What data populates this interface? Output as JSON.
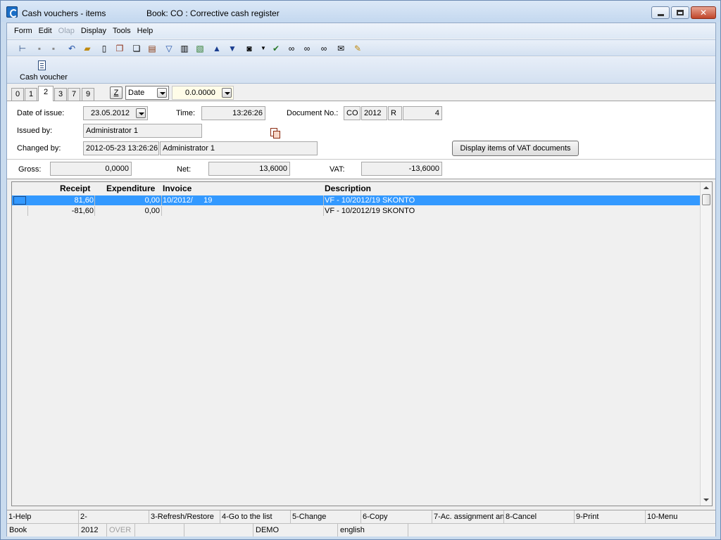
{
  "window": {
    "title": "Cash vouchers - items",
    "book": "Book: CO : Corrective cash register"
  },
  "menu": [
    "Form",
    "Edit",
    "Olap",
    "Display",
    "Tools",
    "Help"
  ],
  "ribbon": {
    "cash_voucher": "Cash voucher"
  },
  "tabs": [
    "0",
    "1",
    "2",
    "3",
    "7",
    "9"
  ],
  "filter": {
    "z_label": "Z",
    "sort_value": "Date",
    "amount_value": "0.0.0000"
  },
  "form": {
    "date_of_issue_label": "Date of issue:",
    "date_of_issue": "23.05.2012",
    "time_label": "Time:",
    "time": "13:26:26",
    "document_no_label": "Document No.:",
    "document_no": {
      "book": "CO",
      "year": "2012",
      "type": "R",
      "number": "4"
    },
    "issued_by_label": "Issued by:",
    "issued_by": "Administrator 1",
    "changed_by_label": "Changed by:",
    "changed_at": "2012-05-23 13:26:26",
    "changed_by": "Administrator 1",
    "vat_button": "Display items of VAT documents"
  },
  "summary": {
    "gross_label": "Gross:",
    "gross": "0,0000",
    "net_label": "Net:",
    "net": "13,6000",
    "vat_label": "VAT:",
    "vat": "-13,6000"
  },
  "grid": {
    "headers": {
      "receipt": "Receipt",
      "expenditure": "Expenditure",
      "invoice": "Invoice",
      "description": "Description"
    },
    "rows": [
      {
        "receipt": "81,60",
        "expenditure": "0,00",
        "invoice": "10/2012/     19",
        "description": "VF - 10/2012/19 SKONTO"
      },
      {
        "receipt": "-81,60",
        "expenditure": "0,00",
        "invoice": "",
        "description": "VF - 10/2012/19 SKONTO"
      }
    ]
  },
  "fkeys": [
    "1-Help",
    "2-",
    "3-Refresh/Restore",
    "4-Go to the list",
    "5-Change",
    "6-Copy",
    "7-Ac. assignment an",
    "8-Cancel",
    "9-Print",
    "10-Menu"
  ],
  "status": {
    "book": "Book",
    "year": "2012",
    "over": "OVER",
    "demo": "DEMO",
    "language": "english"
  }
}
